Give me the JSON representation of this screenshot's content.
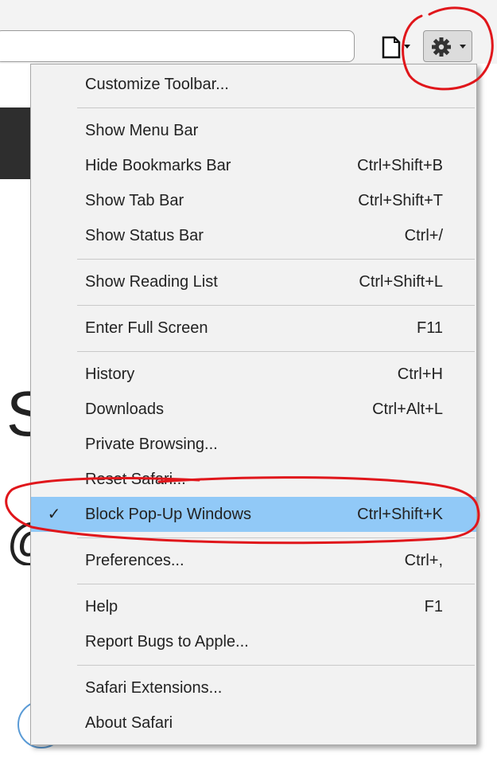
{
  "toolbar": {
    "page_icon": "page-menu-icon",
    "gear_icon": "gear-icon",
    "chevron_icon": "chevron-down-icon"
  },
  "menu": {
    "groups": [
      [
        {
          "label": "Customize Toolbar...",
          "shortcut": ""
        }
      ],
      [
        {
          "label": "Show Menu Bar",
          "shortcut": ""
        },
        {
          "label": "Hide Bookmarks Bar",
          "shortcut": "Ctrl+Shift+B"
        },
        {
          "label": "Show Tab Bar",
          "shortcut": "Ctrl+Shift+T"
        },
        {
          "label": "Show Status Bar",
          "shortcut": "Ctrl+/"
        }
      ],
      [
        {
          "label": "Show Reading List",
          "shortcut": "Ctrl+Shift+L"
        }
      ],
      [
        {
          "label": "Enter Full Screen",
          "shortcut": "F11"
        }
      ],
      [
        {
          "label": "History",
          "shortcut": "Ctrl+H"
        },
        {
          "label": "Downloads",
          "shortcut": "Ctrl+Alt+L"
        },
        {
          "label": "Private Browsing...",
          "shortcut": ""
        },
        {
          "label": "Reset Safari...",
          "shortcut": ""
        },
        {
          "label": "Block Pop-Up Windows",
          "shortcut": "Ctrl+Shift+K",
          "checked": true,
          "highlighted": true
        }
      ],
      [
        {
          "label": "Preferences...",
          "shortcut": "Ctrl+,"
        }
      ],
      [
        {
          "label": "Help",
          "shortcut": "F1"
        },
        {
          "label": "Report Bugs to Apple...",
          "shortcut": ""
        }
      ],
      [
        {
          "label": "Safari Extensions...",
          "shortcut": ""
        },
        {
          "label": "About Safari",
          "shortcut": ""
        }
      ]
    ],
    "check_mark": "✓"
  },
  "background": {
    "glyph_1": "S",
    "glyph_2": "@"
  },
  "colors": {
    "highlight": "#91c9f7",
    "annotation": "#e0161b",
    "menu_bg": "#f2f2f2"
  }
}
